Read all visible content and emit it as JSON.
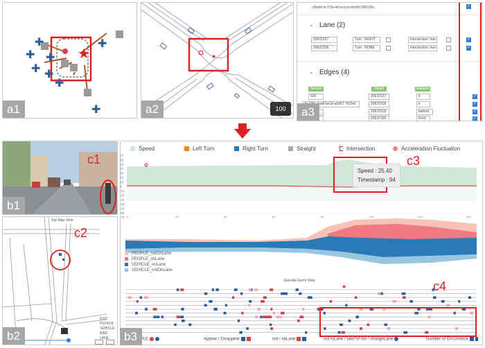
{
  "labels": {
    "a1": "a1",
    "a2": "a2",
    "a3": "a3",
    "b1": "b1",
    "b2": "b2",
    "b3": "b3",
    "c1": "c1",
    "c2": "c2",
    "c3": "c3",
    "c4": "c4"
  },
  "a2": {
    "badge": "100"
  },
  "a3": {
    "id_top": "d5ed4 fe-27fa-4e5a-b1e-b5d5574f0196c",
    "lane_title": "Lane (2)",
    "lane_rows": [
      {
        "id": "20637227",
        "turn": "Turn : RIGHT",
        "inter": "intersection: true"
      },
      {
        "id": "20637228",
        "turn": "Turn : NONE",
        "inter": "intersection: true"
      }
    ],
    "edges_title": "Edges (4)",
    "edge_headers": {
      "source": "Source",
      "target": "Target",
      "relation": "Relation"
    },
    "edge_rows": [
      {
        "source": "620",
        "target": "20637227",
        "relation": "ir"
      },
      {
        "source": "fe-27fa-4ae8-be1b-a5d57 7f10e0",
        "target": "20637018",
        "relation": "ir"
      },
      {
        "source": "",
        "target": "20637018",
        "relation": "behind"
      },
      {
        "source": "d",
        "target": "20637195",
        "relation": "front"
      }
    ]
  },
  "b2": {
    "title": "Top Map View",
    "legend": [
      "EGO",
      "PEOPLE",
      "VEHICLE",
      "BIKE",
      "LANE"
    ]
  },
  "b3": {
    "legend": {
      "speed": "Speed",
      "left_turn": "Left Turn",
      "right_turn": "Right Turn",
      "straight": "Straight",
      "intersection": "Intersection",
      "accel": "Acceleration Fluctuation"
    },
    "y_ticks": [
      "70",
      "60",
      "50",
      "40",
      "30",
      "20",
      "10",
      "0",
      "-10",
      "-20",
      "-30",
      "-40",
      "-50",
      "-60",
      "-70"
    ],
    "x_ticks": [
      "0",
      "20",
      "40",
      "60",
      "80",
      "100",
      "120",
      "140"
    ],
    "tooltip": {
      "speed": "Speed : 25.40",
      "timestamp": "Timestamp : 94"
    },
    "stream_legend": [
      "PEOPLE_notOnLane",
      "PEOPLE_onLane",
      "VEHICLE_onLane",
      "VEHICLE_notOnLane"
    ],
    "event_title": "Episode Event View",
    "footer": {
      "f1": "OLE / PEOPLE",
      "f2": "Appear / Disappear",
      "f3": "not / onLane",
      "f4": "not toLane / take*of not / changeLane",
      "f5": "Number of Occurrence"
    }
  },
  "colors": {
    "red": "#e02020",
    "speed_fill": "#cfe8d8",
    "people_not": "#f8c2b6",
    "people_on": "#f07a80",
    "vehicle_on": "#2a7ab8",
    "vehicle_not": "#98c6e0",
    "plus_blue": "#2e5e9a"
  }
}
